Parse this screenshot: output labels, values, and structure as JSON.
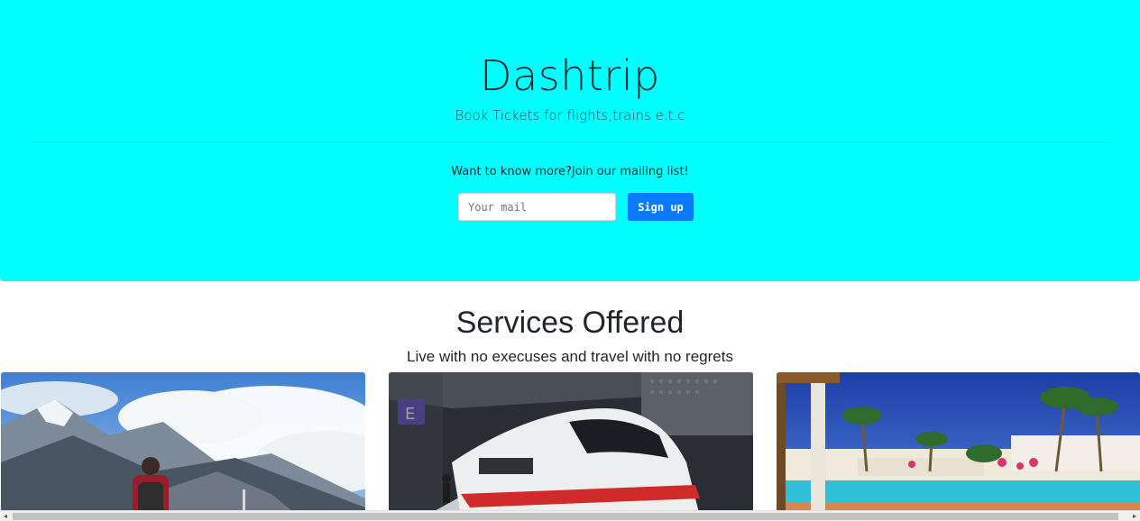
{
  "hero": {
    "title": "Dashtrip",
    "subtitle": "Book Tickets for flights,trains e.t.c",
    "mailing_text": "Want to know more?Join our mailing list!",
    "mail_placeholder": "Your mail",
    "signup_label": "Sign up",
    "background_color": "#00ffff",
    "button_color": "#0a7bff"
  },
  "services": {
    "title": "Services Offered",
    "subtitle": "Live with no execuses and travel with no regrets",
    "cards": [
      {
        "image": "mountain-hiker-image"
      },
      {
        "image": "high-speed-train-image"
      },
      {
        "image": "resort-pool-image"
      }
    ]
  },
  "scrollbar": {
    "left_arrow": "◂",
    "right_arrow": "▸"
  }
}
